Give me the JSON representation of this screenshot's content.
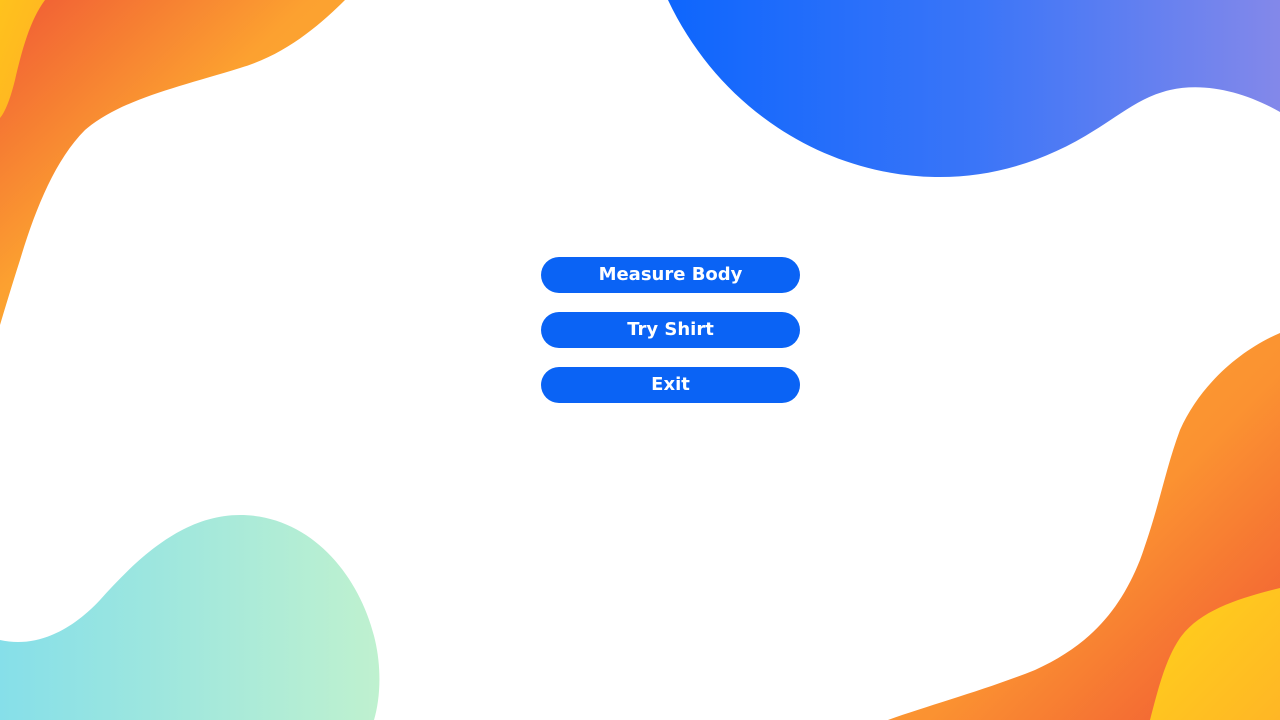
{
  "menu": {
    "buttons": [
      {
        "label": "Measure Body"
      },
      {
        "label": "Try Shirt"
      },
      {
        "label": "Exit"
      }
    ]
  },
  "colors": {
    "background": "#ffffff",
    "button": "#0a63f5",
    "button_text": "#ffffff",
    "blob_blue_start": "#0e66fd",
    "blob_blue_end": "#8388ea",
    "blob_orange_start": "#f06535",
    "blob_orange_mid": "#fca130",
    "blob_yellow": "#ffd21b",
    "blob_teal_start": "#86dfe9",
    "blob_teal_end": "#bff1cf"
  }
}
